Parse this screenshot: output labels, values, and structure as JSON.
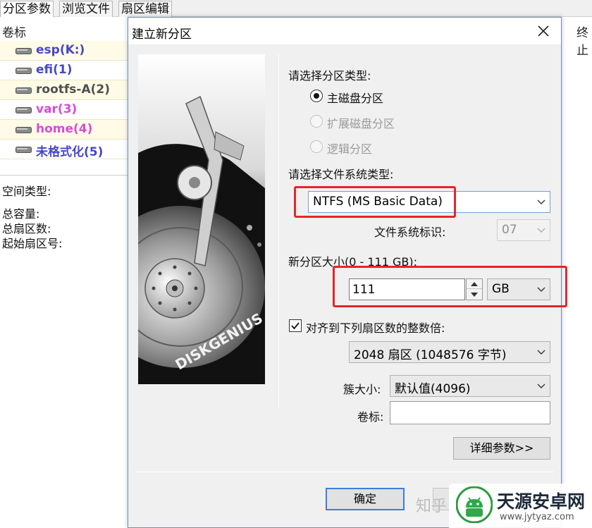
{
  "tabs": [
    {
      "label": "分区参数"
    },
    {
      "label": "浏览文件"
    },
    {
      "label": "扇区编辑"
    }
  ],
  "partition_list": {
    "header_volume": "卷标",
    "header_end": "终止",
    "items": [
      {
        "label": "esp(K:)",
        "color": "#4747c9"
      },
      {
        "label": "efi(1)",
        "color": "#4747c9"
      },
      {
        "label": "rootfs-A(2)",
        "color": "#4f4f4f"
      },
      {
        "label": "var(3)",
        "color": "#d94bd6"
      },
      {
        "label": "home(4)",
        "color": "#d94bd6"
      },
      {
        "label": "未格式化(5)",
        "color": "#4747c9"
      }
    ]
  },
  "info_panel": {
    "space_type": "空间类型:",
    "total_capacity": "总容量:",
    "total_sectors": "总扇区数:",
    "start_sector": "起始扇区号:"
  },
  "dialog": {
    "title": "建立新分区",
    "art_brand": "DISKGENIUS",
    "partition_type_label": "请选择分区类型:",
    "partition_types": [
      {
        "label": "主磁盘分区",
        "selected": true,
        "enabled": true
      },
      {
        "label": "扩展磁盘分区",
        "selected": false,
        "enabled": false
      },
      {
        "label": "逻辑分区",
        "selected": false,
        "enabled": false
      }
    ],
    "fs_type_label": "请选择文件系统类型:",
    "fs_type_value": "NTFS (MS Basic Data)",
    "fs_id_label": "文件系统标识:",
    "fs_id_value": "07",
    "size_label": "新分区大小(0 - 111 GB):",
    "size_value": "111",
    "size_unit": "GB",
    "align_label": "对齐到下列扇区数的整数倍:",
    "align_checked": true,
    "align_value": "2048 扇区 (1048576 字节)",
    "cluster_label": "簇大小:",
    "cluster_value": "默认值(4096)",
    "volume_label": "卷标:",
    "volume_value": "",
    "details_button": "详细参数>>",
    "ok_button": "确定"
  },
  "watermarks": {
    "zhihu": "知乎",
    "site_name": "天源安卓网",
    "site_url": "www.jytyaz.com"
  },
  "colors": {
    "highlight_box": "#e5262b",
    "accent": "#3c7fd4"
  }
}
